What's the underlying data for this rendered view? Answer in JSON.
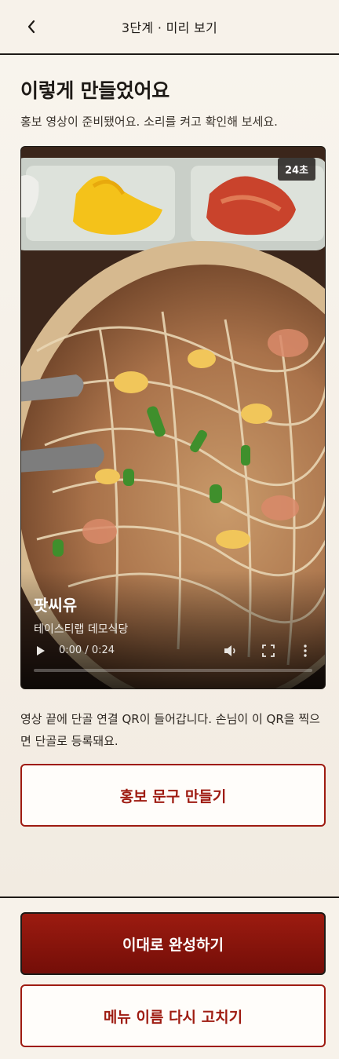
{
  "header": {
    "back_icon": "chevron-left-icon",
    "title": "3단계 · 미리 보기"
  },
  "main": {
    "heading": "이렇게 만들었어요",
    "subtext": "홍보 영상이 준비됐어요. 소리를 켜고 확인해 보세요.",
    "video": {
      "duration_badge": "24초",
      "dish_name": "팟씨유",
      "store_name": "테이스티랩 데모식당",
      "time_display": "0:00 / 0:24",
      "progress": 0.0,
      "icons": [
        "play-icon",
        "volume-icon",
        "fullscreen-icon",
        "more-vertical-icon"
      ]
    },
    "qr_note": "영상 끝에 단골 연결 QR이 들어갑니다. 손님이 이 QR을 찍으면 단골로 등록돼요.",
    "promo_button_label": "홍보 문구 만들기"
  },
  "footer": {
    "complete_button_label": "이대로 완성하기",
    "edit_menu_button_label": "메뉴 이름 다시 고치기"
  },
  "colors": {
    "background": "#f7f2ea",
    "accent": "#9e1b11",
    "accent_dark": "#740e08",
    "text": "#1e1a16"
  }
}
